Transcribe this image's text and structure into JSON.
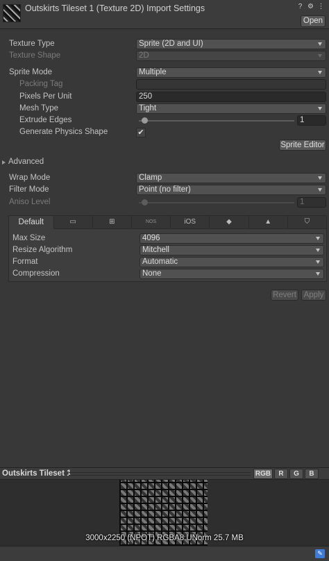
{
  "header": {
    "title": "Outskirts Tileset 1 (Texture 2D) Import Settings",
    "help_icon": "help-icon",
    "settings_icon": "settings-icon",
    "menu_icon": "more-menu-icon",
    "open_label": "Open"
  },
  "fields": {
    "texture_type": {
      "label": "Texture Type",
      "value": "Sprite (2D and UI)"
    },
    "texture_shape": {
      "label": "Texture Shape",
      "value": "2D"
    },
    "sprite_mode": {
      "label": "Sprite Mode",
      "value": "Multiple"
    },
    "packing_tag": {
      "label": "Packing Tag",
      "value": ""
    },
    "pixels_per_unit": {
      "label": "Pixels Per Unit",
      "value": "250"
    },
    "mesh_type": {
      "label": "Mesh Type",
      "value": "Tight"
    },
    "extrude_edges": {
      "label": "Extrude Edges",
      "value": "1"
    },
    "generate_physics": {
      "label": "Generate Physics Shape",
      "checked": "✔"
    },
    "sprite_editor_label": "Sprite Editor",
    "advanced_label": "Advanced",
    "wrap_mode": {
      "label": "Wrap Mode",
      "value": "Clamp"
    },
    "filter_mode": {
      "label": "Filter Mode",
      "value": "Point (no filter)"
    },
    "aniso_level": {
      "label": "Aniso Level",
      "value": "1"
    }
  },
  "platform": {
    "tabs": [
      {
        "label": "Default",
        "icon": ""
      },
      {
        "label": "",
        "icon": "monitor-icon",
        "glyph": "▭"
      },
      {
        "label": "",
        "icon": "windows-icon",
        "glyph": "⊞"
      },
      {
        "label": "NOS",
        "icon": ""
      },
      {
        "label": "iOS",
        "icon": ""
      },
      {
        "label": "",
        "icon": "xr-headset-icon",
        "glyph": "◆"
      },
      {
        "label": "",
        "icon": "android-icon",
        "glyph": "▲"
      },
      {
        "label": "",
        "icon": "html5-icon",
        "glyph": "⛉"
      }
    ],
    "max_size": {
      "label": "Max Size",
      "value": "4096"
    },
    "resize_algorithm": {
      "label": "Resize Algorithm",
      "value": "Mitchell"
    },
    "format": {
      "label": "Format",
      "value": "Automatic"
    },
    "compression": {
      "label": "Compression",
      "value": "None"
    }
  },
  "actions": {
    "revert_label": "Revert",
    "apply_label": "Apply"
  },
  "preview": {
    "title": "Outskirts Tileset 1",
    "channels": [
      "RGB",
      "R",
      "G",
      "B"
    ],
    "info": "3000x2250 (NPOT)  RGBA8 UNorm   25.7 MB",
    "tag_icon": "asset-label-icon"
  }
}
